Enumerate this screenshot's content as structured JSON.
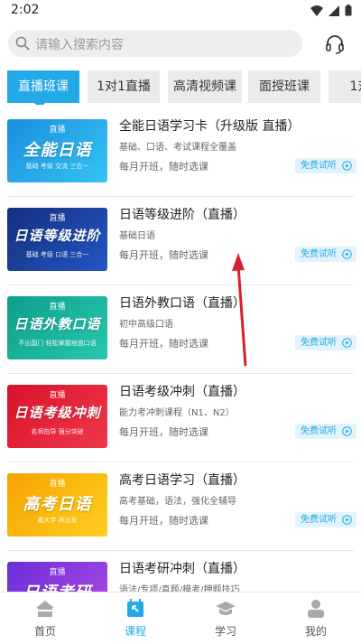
{
  "status_bar": {
    "time": "2:02"
  },
  "search": {
    "placeholder": "请输入搜索内容"
  },
  "tabs": [
    {
      "label": "直播班课"
    },
    {
      "label": "1对1直播"
    },
    {
      "label": "高清视频课"
    },
    {
      "label": "面授班课"
    },
    {
      "label": "1对"
    }
  ],
  "courses": [
    {
      "title": "全能日语学习卡（升级版 直播）",
      "desc": "基础、口语、考试课程全覆盖",
      "schedule": "每月开班，随时选课",
      "button": "免费试听",
      "thumb": {
        "top": "直播",
        "title": "全能日语",
        "sub": "基础 考级 交流 三合一"
      }
    },
    {
      "title": "日语等级进阶（直播）",
      "desc": "基础日语",
      "schedule": "每月开班，随时选课",
      "button": "免费试听",
      "thumb": {
        "top": "直播",
        "title": "日语等级进阶",
        "sub": "基础 考级 口语 三合一"
      }
    },
    {
      "title": "日语外教口语（直播）",
      "desc": "初中高级口语",
      "schedule": "每月开班，随时选课",
      "button": "免费试听",
      "thumb": {
        "top": "直播",
        "title": "日语外教口语",
        "sub": "不出国门 轻松掌握地道口语"
      }
    },
    {
      "title": "日语考级冲刺（直播）",
      "desc": "能力考冲刺课程（N1、N2）",
      "schedule": "每月开班，随时选课",
      "button": "免费试听",
      "thumb": {
        "top": "直播",
        "title": "日语考级冲刺",
        "sub": "名师指导 强分突破"
      }
    },
    {
      "title": "高考日语学习（直播）",
      "desc": "高考基础，语法，强化全辅导",
      "schedule": "每月开班，随时选课",
      "button": "免费试听",
      "thumb": {
        "top": "直播",
        "title": "高考日语",
        "sub": "赢大学 再出发"
      }
    },
    {
      "title": "日语考研冲刺（直播）",
      "desc": "语法/专项/真题/模考/押题技巧",
      "schedule": "",
      "button": "",
      "thumb": {
        "top": "直播",
        "title": "日语考研",
        "sub": ""
      }
    }
  ],
  "bottom_nav": [
    {
      "label": "首页",
      "icon": "home-icon"
    },
    {
      "label": "课程",
      "icon": "course-icon"
    },
    {
      "label": "学习",
      "icon": "study-icon"
    },
    {
      "label": "我的",
      "icon": "profile-icon"
    }
  ],
  "colors": {
    "accent": "#23a9e6",
    "annotation_arrow": "#d8202c"
  }
}
